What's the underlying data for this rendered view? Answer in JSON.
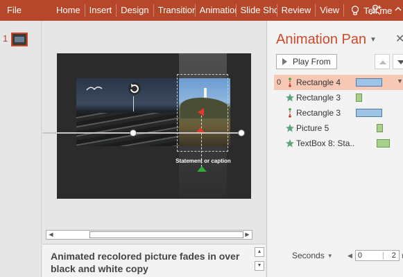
{
  "ribbon": {
    "file": "File",
    "tabs": [
      "Home",
      "Insert",
      "Design",
      "Transitions",
      "Animations",
      "Slide Show",
      "Review",
      "View"
    ],
    "tell_me": "Tell me"
  },
  "thumbnails": {
    "slide_number": "1"
  },
  "slide": {
    "caption": "Statement or caption"
  },
  "notes": {
    "text": "Animated recolored picture fades in over black and white copy"
  },
  "animation_pane": {
    "title": "Animation Pane",
    "play_from": "Play From",
    "items": [
      {
        "number": "0",
        "icon": "motion-path-icon",
        "label": "Rectangle 4",
        "color": "#9dc3e6",
        "selected": true
      },
      {
        "number": "",
        "icon": "star-icon",
        "label": "Rectangle 3",
        "color": "#a9d18e",
        "selected": false
      },
      {
        "number": "",
        "icon": "motion-path-icon",
        "label": "Rectangle 3",
        "color": "#9dc3e6",
        "selected": false
      },
      {
        "number": "",
        "icon": "star-icon",
        "label": "Picture 5",
        "color": "#a9d18e",
        "selected": false
      },
      {
        "number": "",
        "icon": "star-icon",
        "label": "TextBox 8: Sta...",
        "color": "#a9d18e",
        "selected": false
      }
    ],
    "seconds_label": "Seconds",
    "timeline": {
      "start": "0",
      "end": "2"
    }
  },
  "colors": {
    "ribbon": "#b7472a",
    "accent": "#d24726",
    "selection": "#f7c8b4"
  }
}
